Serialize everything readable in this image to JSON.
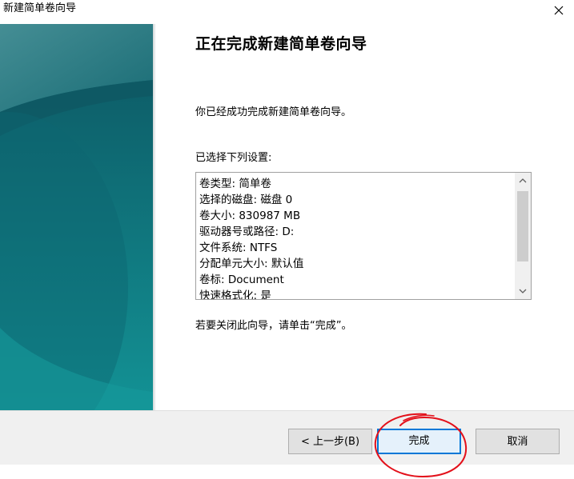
{
  "window": {
    "title": "新建简单卷向导"
  },
  "content": {
    "heading": "正在完成新建简单卷向导",
    "intro": "你已经成功完成新建简单卷向导。",
    "settings_label": "已选择下列设置:",
    "settings": [
      "卷类型: 简单卷",
      "选择的磁盘: 磁盘 0",
      "卷大小: 830987 MB",
      "驱动器号或路径: D:",
      "文件系统: NTFS",
      "分配单元大小: 默认值",
      "卷标: Document",
      "快速格式化: 是"
    ],
    "outro": "若要关闭此向导，请单击“完成”。"
  },
  "buttons": {
    "back": "< 上一步(B)",
    "finish": "完成",
    "cancel": "取消"
  },
  "colors": {
    "accent": "#0078d7",
    "annotation": "#e3101a",
    "banner": "#0f5f6b"
  },
  "icons": {
    "close": "close-icon",
    "scroll_up": "chevron-up-icon",
    "scroll_down": "chevron-down-icon"
  }
}
